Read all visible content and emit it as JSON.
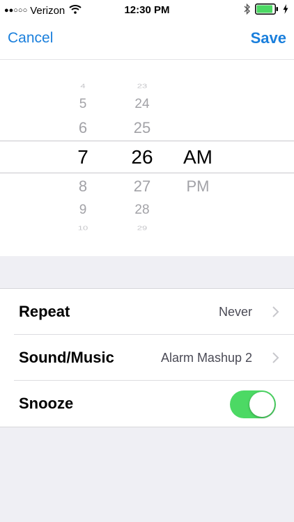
{
  "status_bar": {
    "signal_dots": "●●○○○",
    "carrier": "Verizon",
    "time": "12:30 PM",
    "icons": [
      "wifi-icon",
      "bluetooth-icon",
      "battery-icon",
      "charging-bolt-icon"
    ],
    "battery_level": 0.9,
    "battery_color": "#4cd964"
  },
  "nav": {
    "cancel_label": "Cancel",
    "save_label": "Save",
    "accent_color": "#1a7fdc"
  },
  "picker": {
    "hours": [
      "4",
      "5",
      "6",
      "7",
      "8",
      "9",
      "10"
    ],
    "minutes": [
      "23",
      "24",
      "25",
      "26",
      "27",
      "28",
      "29"
    ],
    "periods": [
      "AM",
      "PM"
    ],
    "selected_hour": "7",
    "selected_minute": "26",
    "selected_period": "AM"
  },
  "settings": {
    "repeat_label": "Repeat",
    "repeat_value": "Never",
    "sound_label": "Sound/Music",
    "sound_value": "Alarm Mashup 2",
    "snooze_label": "Snooze",
    "snooze_on": true,
    "toggle_color": "#4cd964"
  }
}
